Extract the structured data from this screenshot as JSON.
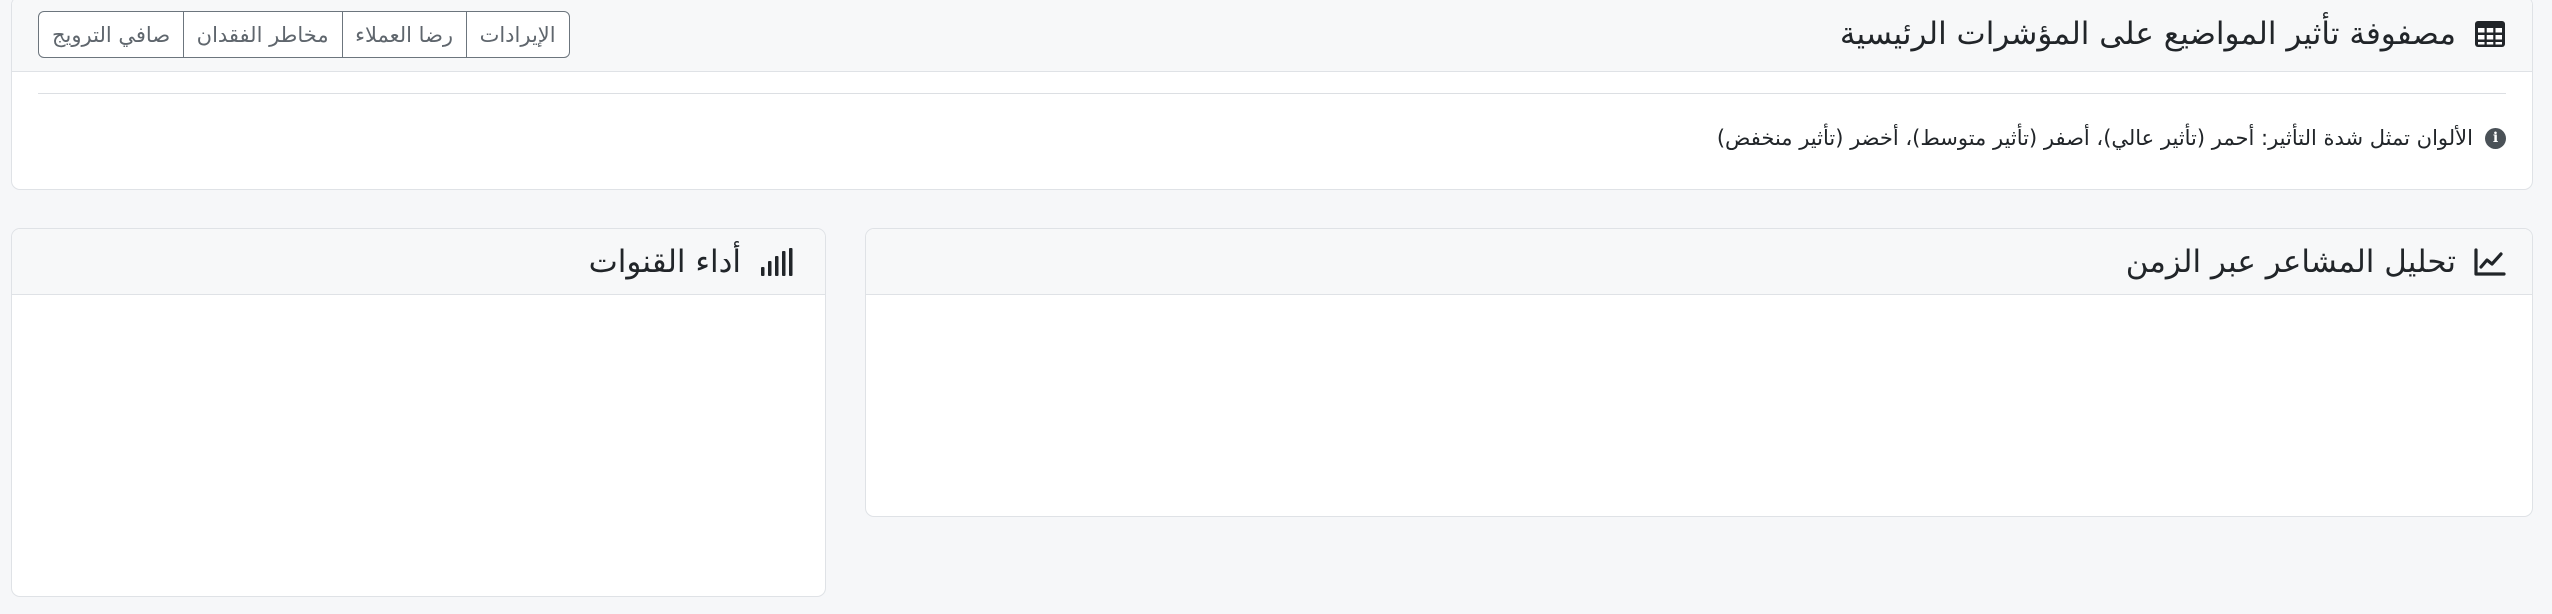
{
  "matrix": {
    "title": "مصفوفة تأثير المواضيع على المؤشرات الرئيسية",
    "icon": "table-icon",
    "kpi_buttons": [
      "الإيرادات",
      "رضا العملاء",
      "مخاطر الفقدان",
      "صافي الترويج"
    ],
    "legend_note": "الألوان تمثل شدة التأثير: أحمر (تأثير عالي)، أصفر (تأثير متوسط)، أخضر (تأثير منخفض)",
    "legend_icon": "info-circle-icon"
  },
  "sentiment": {
    "title": "تحليل المشاعر عبر الزمن",
    "icon": "line-chart-icon"
  },
  "channels": {
    "title": "أداء القنوات",
    "icon": "signal-bars-icon"
  }
}
